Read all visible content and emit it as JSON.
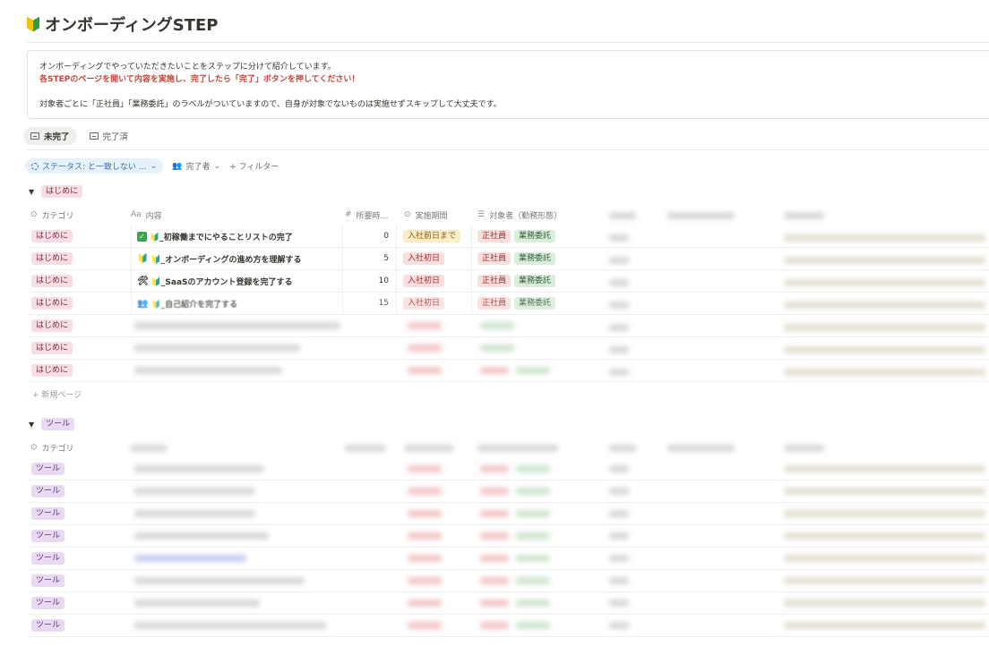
{
  "page": {
    "title": "オンボーディングSTEP",
    "title_icon": "beginner-mark-icon"
  },
  "callout": {
    "line1": "オンボーディングでやっていただきたいことをステップに分けて紹介しています。",
    "line2": "各STEPのページを開いて内容を実施し、完了したら「完了」ボタンを押してください！",
    "line3": "対象者ごとに「正社員」「業務委託」のラベルがついていますので、自身が対象でないものは実施せずスキップして大丈夫です。"
  },
  "views": [
    {
      "label": "未完了",
      "active": true
    },
    {
      "label": "完了済",
      "active": false
    }
  ],
  "filters": {
    "status": "ステータス: と一致しない …",
    "assignee": "完了者",
    "add_filter": "+ フィルター"
  },
  "columns": {
    "category": "カテゴリ",
    "content": "内容",
    "time": "所要時…",
    "period": "実施期間",
    "target": "対象者（勤務形態）"
  },
  "groups": [
    {
      "name": "はじめに",
      "rows": [
        {
          "category": "はじめに",
          "title": "🔰_初稼働までにやることリストの完了",
          "icon": "check-icon",
          "time": "0",
          "period": "入社前日まで",
          "targets": [
            "正社員",
            "業務委託"
          ]
        },
        {
          "category": "はじめに",
          "title": "🔰_オンボーディングの進め方を理解する",
          "icon": "beginner-icon",
          "time": "5",
          "period": "入社初日",
          "targets": [
            "正社員",
            "業務委託"
          ]
        },
        {
          "category": "はじめに",
          "title": "🔰_SaaSのアカウント登録を完了する",
          "icon": "tools-icon",
          "time": "10",
          "period": "入社初日",
          "targets": [
            "正社員",
            "業務委託"
          ]
        },
        {
          "category": "はじめに",
          "title": "🔰_自己紹介を完了する",
          "icon": "people-icon",
          "time": "15",
          "period": "入社初日",
          "targets": [
            "正社員",
            "業務委託"
          ]
        },
        {
          "category": "はじめに"
        },
        {
          "category": "はじめに"
        },
        {
          "category": "はじめに"
        }
      ],
      "new_page": "+ 新規ページ"
    },
    {
      "name": "ツール",
      "rows": [
        {
          "category": "ツール"
        },
        {
          "category": "ツール"
        },
        {
          "category": "ツール"
        },
        {
          "category": "ツール"
        },
        {
          "category": "ツール"
        },
        {
          "category": "ツール"
        },
        {
          "category": "ツール"
        },
        {
          "category": "ツール"
        }
      ]
    }
  ],
  "colors": {
    "callout_red": "#c4443b",
    "tag_pink": "#f9dde4",
    "tag_purple": "#ead9f3",
    "tag_yellow": "#fbedc7",
    "tag_red": "#fbdede",
    "tag_green": "#dbeddb",
    "filter_blue": "#2f6fb2"
  }
}
